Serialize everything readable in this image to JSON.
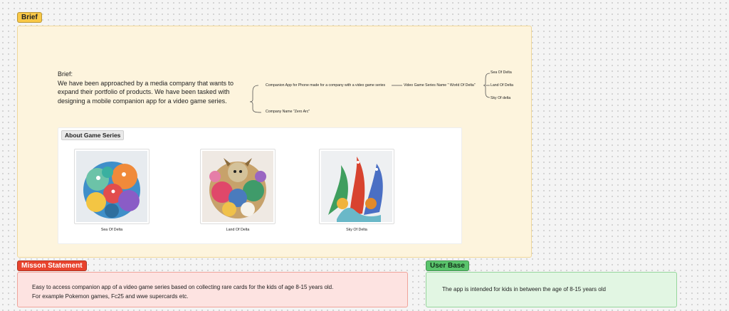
{
  "brief": {
    "tag": "Brief",
    "heading": "Brief:",
    "body": "We have been approached by a media company that wants to expand their portfolio of products. We have been tasked with designing a mobile companion app for a video game series."
  },
  "mindmap": {
    "companion_app": "Companion App for Phone made for a company with a video game series",
    "series_name": "Video Game Series Name \" World Of Delta\"",
    "company_name": "Company Name \"Zero Arc\"",
    "games": [
      "Sea Of Delta",
      "Land Of Delta",
      "Sky Of delta"
    ]
  },
  "about": {
    "title": "About Game Series",
    "games": [
      {
        "caption": "Sea Of Delta",
        "icon": "monster-collage-image"
      },
      {
        "caption": "Land Of Delta",
        "icon": "beast-collage-image"
      },
      {
        "caption": "Sky Of Delta",
        "icon": "dragon-collage-image"
      }
    ]
  },
  "mission": {
    "tag": "Misson Statement",
    "line1": "Easy to access companion app of a video game series based on collecting rare cards for the kids of age 8-15 years old.",
    "line2": "For example Pokemon games, Fc25 and wwe supercards etc."
  },
  "userbase": {
    "tag": "User Base",
    "text": "The app is intended for kids in between the age of 8-15 years old"
  },
  "colors": {
    "brief_tag": "#f9c846",
    "mission_tag": "#e8432d",
    "userbase_tag": "#5ac46c"
  }
}
